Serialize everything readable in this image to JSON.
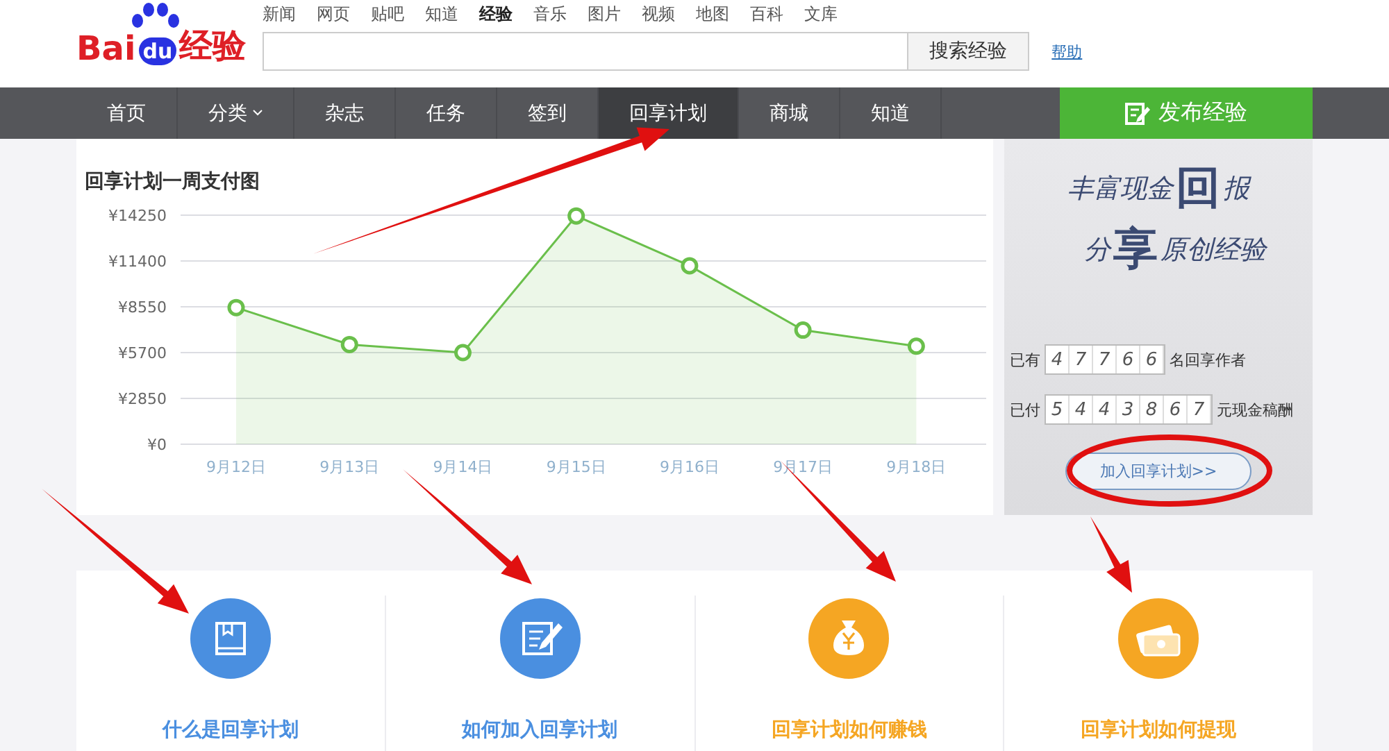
{
  "logo": {
    "part1": "Bai",
    "part2": "du",
    "part3": "经验"
  },
  "top_links": [
    {
      "label": "新闻",
      "selected": false
    },
    {
      "label": "网页",
      "selected": false
    },
    {
      "label": "贴吧",
      "selected": false
    },
    {
      "label": "知道",
      "selected": false
    },
    {
      "label": "经验",
      "selected": true
    },
    {
      "label": "音乐",
      "selected": false
    },
    {
      "label": "图片",
      "selected": false
    },
    {
      "label": "视频",
      "selected": false
    },
    {
      "label": "地图",
      "selected": false
    },
    {
      "label": "百科",
      "selected": false
    },
    {
      "label": "文库",
      "selected": false
    }
  ],
  "search": {
    "button": "搜索经验",
    "help": "帮助"
  },
  "nav": [
    {
      "label": "首页",
      "selected": false,
      "has_menu": false
    },
    {
      "label": "分类",
      "selected": false,
      "has_menu": true
    },
    {
      "label": "杂志",
      "selected": false,
      "has_menu": false
    },
    {
      "label": "任务",
      "selected": false,
      "has_menu": false
    },
    {
      "label": "签到",
      "selected": false,
      "has_menu": false
    },
    {
      "label": "回享计划",
      "selected": true,
      "has_menu": false
    },
    {
      "label": "商城",
      "selected": false,
      "has_menu": false
    },
    {
      "label": "知道",
      "selected": false,
      "has_menu": false
    }
  ],
  "publish_button": "发布经验",
  "chart_title": "回享计划一周支付图",
  "chart_data": {
    "type": "area",
    "categories": [
      "9月12日",
      "9月13日",
      "9月14日",
      "9月15日",
      "9月16日",
      "9月17日",
      "9月18日"
    ],
    "grid": true,
    "series": [
      {
        "color": "#6abf4b",
        "values": [
          8500,
          6200,
          5700,
          14200,
          11100,
          7100,
          6100
        ]
      }
    ],
    "ylim": [
      0,
      14250
    ],
    "yticks": [
      {
        "value": 0,
        "label": "¥0"
      },
      {
        "value": 2850,
        "label": "¥2850"
      },
      {
        "value": 5700,
        "label": "¥5700"
      },
      {
        "value": 8550,
        "label": "¥8550"
      },
      {
        "value": 11400,
        "label": "¥11400"
      },
      {
        "value": 14250,
        "label": "¥14250"
      }
    ]
  },
  "banner": {
    "line1_a": "丰富现金",
    "line1_b": "回",
    "line1_c": "报",
    "line2_a": "分",
    "line2_b": "享",
    "line2_c": "原创经验"
  },
  "stats": [
    {
      "prefix": "已有",
      "digits": [
        "4",
        "7",
        "7",
        "6",
        "6"
      ],
      "suffix": "名回享作者"
    },
    {
      "prefix": "已付",
      "digits": [
        "5",
        "4",
        "4",
        "3",
        "8",
        "6",
        "7"
      ],
      "suffix": "元现金稿酬"
    }
  ],
  "join_button": "加入回享计划>>",
  "cards": [
    {
      "title": "什么是回享计划",
      "color": "#4a8fe0"
    },
    {
      "title": "如何加入回享计划",
      "color": "#4a8fe0"
    },
    {
      "title": "回享计划如何赚钱",
      "color": "#f5a623"
    },
    {
      "title": "回享计划如何提现",
      "color": "#f5a623"
    }
  ]
}
